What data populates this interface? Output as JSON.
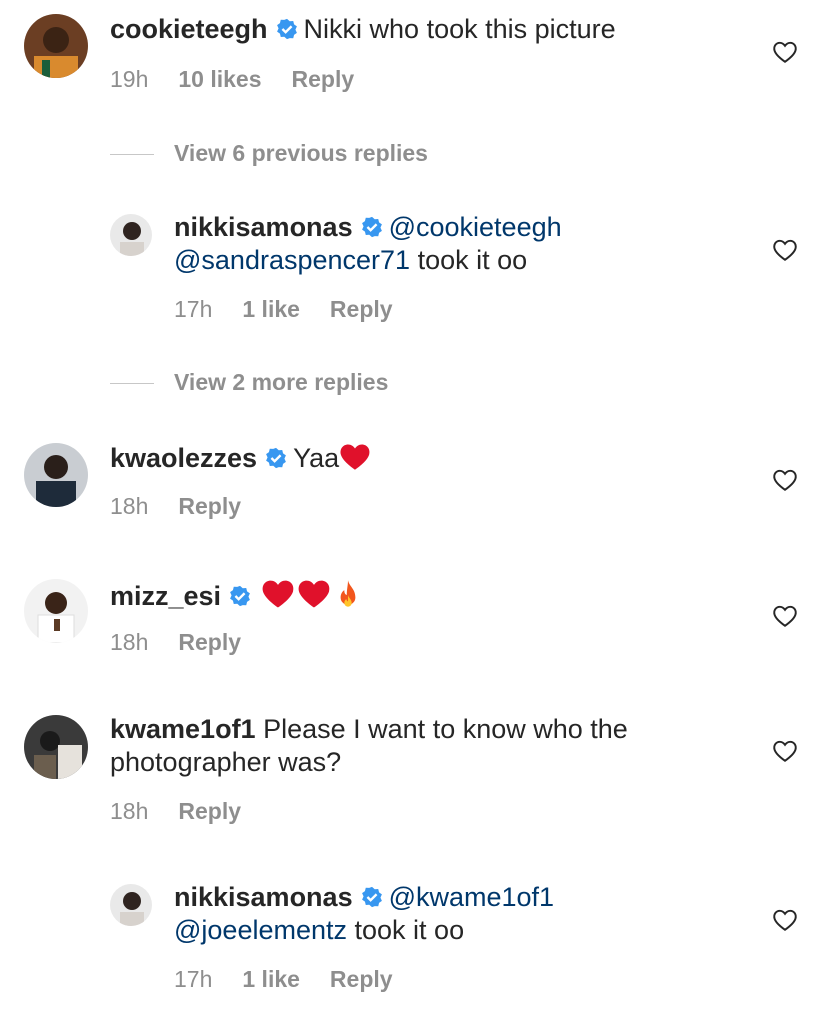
{
  "colors": {
    "accent": "#00376b",
    "meta": "#8e8e8e",
    "verified": "#3897f0",
    "heart_red": "#e0112b"
  },
  "comments": [
    {
      "username": "cookieteegh",
      "text": "Nikki who took this picture",
      "time": "19h",
      "likes": "10 likes",
      "reply": "Reply",
      "verified": true,
      "avatar": "avatar-cookieteegh"
    },
    {
      "view_more": "View 6 previous replies"
    },
    {
      "username": "nikkisamonas",
      "mention1": "@cookieteegh",
      "mention2": "@sandraspencer71",
      "text": "took it oo",
      "time": "17h",
      "likes": "1 like",
      "reply": "Reply",
      "verified": true,
      "avatar": "avatar-nikkisamonas"
    },
    {
      "view_more": "View 2 more replies"
    },
    {
      "username": "kwaolezzes",
      "text": "Yaa",
      "emoji": [
        "red-heart"
      ],
      "time": "18h",
      "reply": "Reply",
      "verified": true,
      "avatar": "avatar-kwaolezzes"
    },
    {
      "username": "mizz_esi",
      "emoji": [
        "red-heart",
        "red-heart",
        "fire"
      ],
      "time": "18h",
      "reply": "Reply",
      "verified": true,
      "avatar": "avatar-mizz-esi"
    },
    {
      "username": "kwame1of1",
      "text_line1": "Please I want to know who the",
      "text_line2": "photographer was?",
      "time": "18h",
      "reply": "Reply",
      "verified": false,
      "avatar": "avatar-kwame1of1"
    },
    {
      "username": "nikkisamonas",
      "mention1": "@kwame1of1",
      "mention2": "@joeelementz",
      "text": "took it oo",
      "time": "17h",
      "likes": "1 like",
      "reply": "Reply",
      "verified": true,
      "avatar": "avatar-nikkisamonas"
    }
  ]
}
